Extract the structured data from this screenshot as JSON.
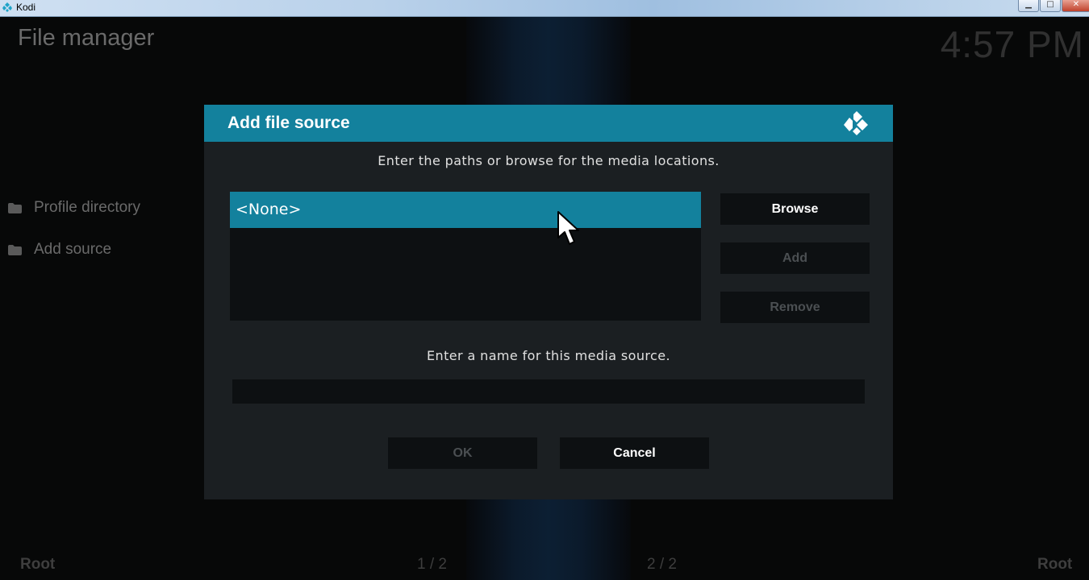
{
  "window": {
    "title": "Kodi",
    "controls": [
      "minimize",
      "maximize",
      "close"
    ]
  },
  "screen": {
    "title": "File manager",
    "clock": "4:57 PM",
    "sidebar": {
      "items": [
        {
          "label": "Profile directory",
          "icon": "folder-icon"
        },
        {
          "label": "Add source",
          "icon": "folder-icon"
        }
      ]
    },
    "footer": {
      "left_label": "Root",
      "left_page": "1 / 2",
      "right_page": "2 / 2",
      "right_label": "Root"
    }
  },
  "dialog": {
    "title": "Add file source",
    "paths_instruction": "Enter the paths or browse for the media locations.",
    "paths": [
      "<None>"
    ],
    "buttons": {
      "browse": "Browse",
      "add": "Add",
      "remove": "Remove",
      "ok": "OK",
      "cancel": "Cancel"
    },
    "name_instruction": "Enter a name for this media source.",
    "name_value": ""
  },
  "colors": {
    "accent": "#13819d",
    "dialog_bg": "#1b1f22",
    "field_bg": "#0d1012",
    "disabled_text": "#4b4f52"
  }
}
